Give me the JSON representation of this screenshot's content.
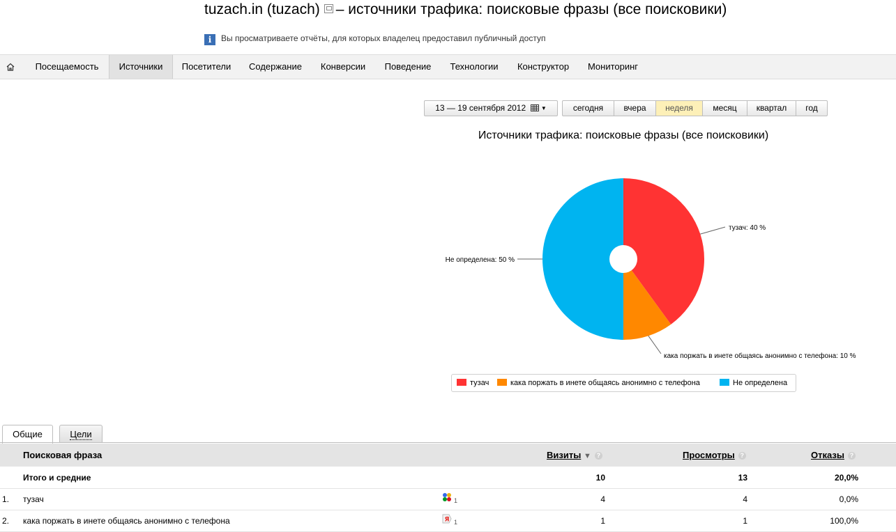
{
  "page": {
    "title_prefix": "tuzach.in (tuzach)",
    "title_suffix": "– источники трафика: поисковые фразы (все поисковики)",
    "notice": "Вы просматриваете отчёты, для которых владелец предоставил публичный доступ"
  },
  "nav": {
    "items": [
      {
        "label": "Посещаемость"
      },
      {
        "label": "Источники"
      },
      {
        "label": "Посетители"
      },
      {
        "label": "Содержание"
      },
      {
        "label": "Конверсии"
      },
      {
        "label": "Поведение"
      },
      {
        "label": "Технологии"
      },
      {
        "label": "Конструктор"
      },
      {
        "label": "Мониторинг"
      }
    ],
    "active": "Источники"
  },
  "date_range": {
    "label": "13 — 19 сентября 2012"
  },
  "periods": [
    {
      "label": "сегодня"
    },
    {
      "label": "вчера"
    },
    {
      "label": "неделя"
    },
    {
      "label": "месяц"
    },
    {
      "label": "квартал"
    },
    {
      "label": "год"
    }
  ],
  "active_period": "неделя",
  "chart_data": {
    "type": "pie",
    "title": "Источники трафика: поисковые фразы (все поисковики)",
    "slices": [
      {
        "name": "тузач",
        "value": 40,
        "color": "#ff3333",
        "label": "тузач: 40 %"
      },
      {
        "name": "кака поржать в инете общаясь анонимно с телефона",
        "value": 10,
        "color": "#ff8800",
        "label": "кака поржать в инете общаясь анонимно с телефона: 10 %"
      },
      {
        "name": "Не определена",
        "value": 50,
        "color": "#00b4f0",
        "label": "Не определена: 50 %"
      }
    ],
    "legend": [
      {
        "name": "тузач",
        "color": "#ff3333"
      },
      {
        "name": "кака поржать в инете общаясь анонимно с телефона",
        "color": "#ff8800"
      },
      {
        "name": "Не определена",
        "color": "#00b4f0"
      }
    ],
    "legend_position": "bottom"
  },
  "tabs": [
    {
      "label": "Общие"
    },
    {
      "label": "Цели"
    }
  ],
  "table": {
    "headers": {
      "phrase": "Поисковая фраза",
      "visits": "Визиты",
      "sort_marker": "▼",
      "views": "Просмотры",
      "bounces": "Отказы",
      "help": "?"
    },
    "total": {
      "label": "Итого и средние",
      "visits": "10",
      "views": "13",
      "bounces": "20,0%"
    },
    "rows": [
      {
        "index": "1.",
        "phrase": "тузач",
        "engine": "google-icon",
        "engine_count": "1",
        "visits": "4",
        "views": "4",
        "bounces": "0,0%"
      },
      {
        "index": "2.",
        "phrase": "кака поржать в инете общаясь анонимно с телефона",
        "engine": "yandex-icon",
        "engine_count": "1",
        "visits": "1",
        "views": "1",
        "bounces": "100,0%"
      }
    ]
  },
  "icons": {
    "home": "home-icon",
    "info": "info-icon",
    "calendar": "calendar-icon"
  }
}
